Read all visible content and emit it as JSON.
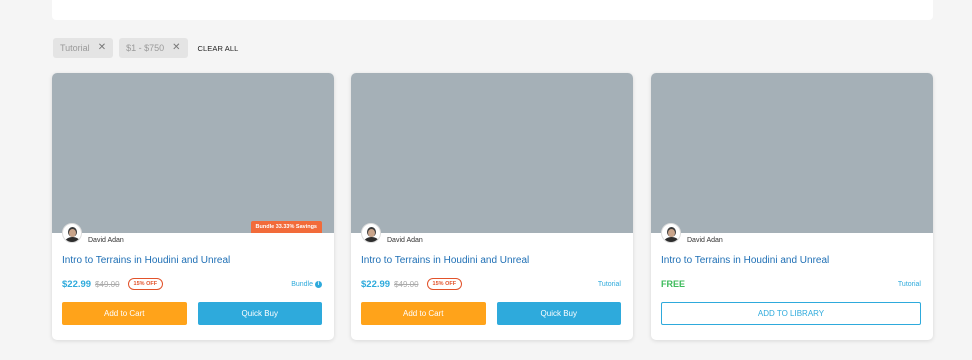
{
  "filters": [
    {
      "label": "Tutorial",
      "remove_icon": "close-icon"
    },
    {
      "label": "$1 - $750",
      "remove_icon": "close-icon"
    }
  ],
  "clear_all_label": "CLEAR ALL",
  "cards": [
    {
      "badge": "Bundle 33.33% Savings",
      "author": "David Adan",
      "title": "Intro to Terrains in Houdini and Unreal",
      "price": "$22.99",
      "old_price": "$49.00",
      "discount": "15% OFF",
      "category": "Bundle",
      "primary_label": "Add to Cart",
      "secondary_label": "Quick Buy"
    },
    {
      "author": "David Adan",
      "title": "Intro to Terrains in Houdini and Unreal",
      "price": "$22.99",
      "old_price": "$49.00",
      "discount": "15% OFF",
      "category": "Tutorial",
      "primary_label": "Add to Cart",
      "secondary_label": "Quick Buy"
    },
    {
      "author": "David Adan",
      "title": "Intro to Terrains in Houdini and Unreal",
      "price": "FREE",
      "category": "Tutorial",
      "primary_label": "ADD TO LIBRARY"
    }
  ],
  "colors": {
    "accent_blue": "#2eaadc",
    "cart_orange": "#ffa31a",
    "badge_orange": "#f26b3a",
    "discount_red": "#e2522a",
    "free_green": "#3dbb5b",
    "thumbnail_gray": "#a5b0b7"
  }
}
